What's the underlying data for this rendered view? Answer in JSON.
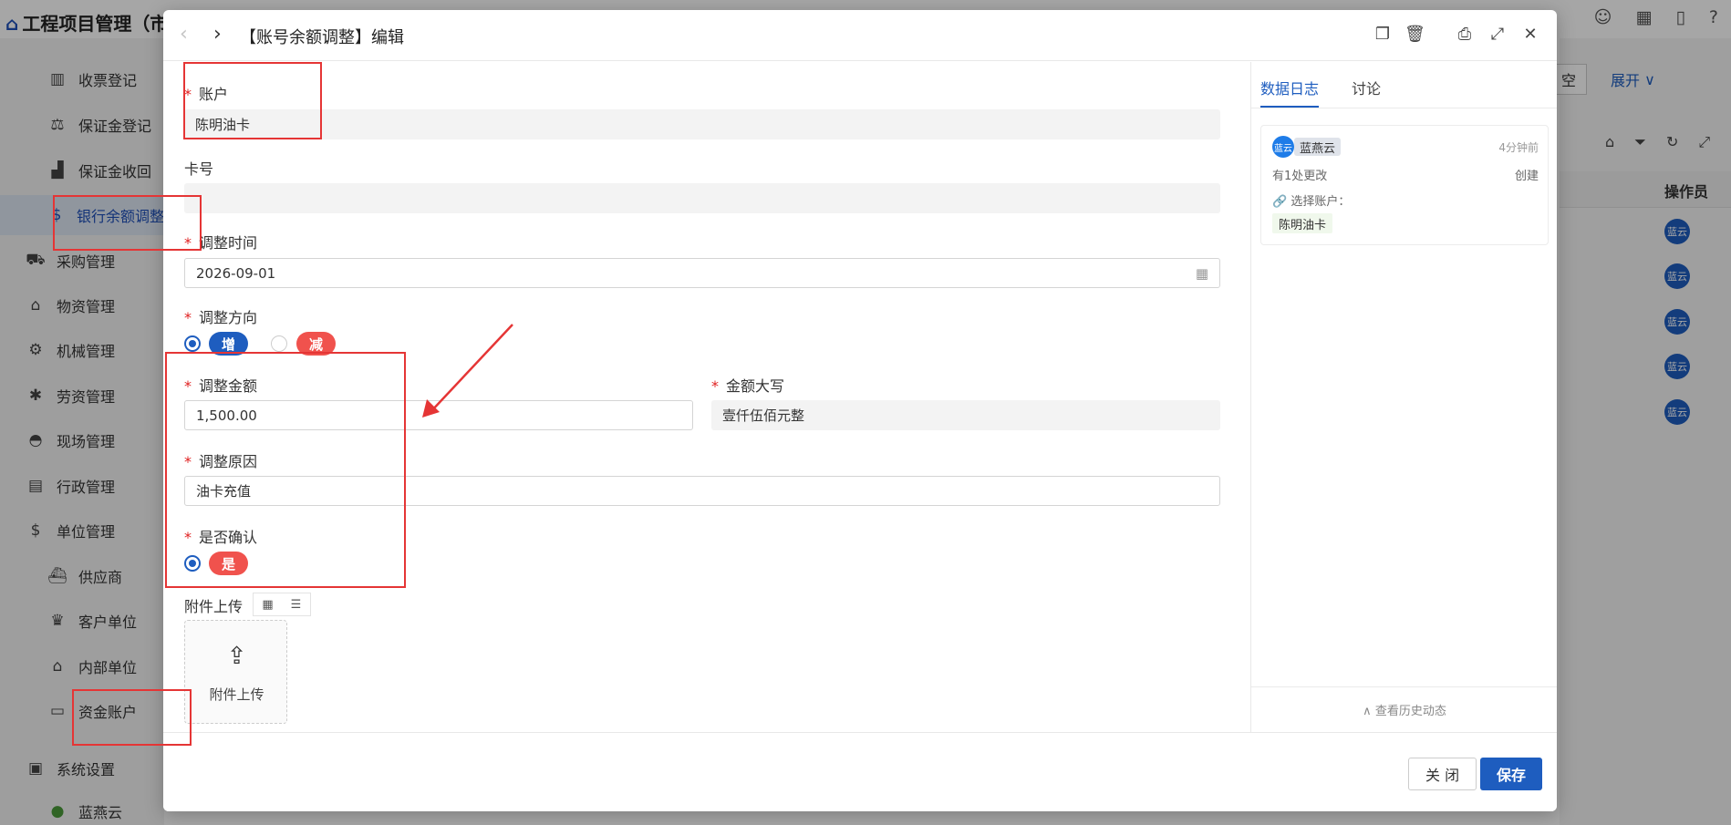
{
  "app": {
    "title": "工程项目管理（市",
    "top_icons": [
      "chat-icon",
      "grid-icon",
      "mobile-icon",
      "help-icon"
    ]
  },
  "sidebar": {
    "items": [
      {
        "label": "收票登记",
        "icon": "barcode-icon",
        "level": 2,
        "active": false
      },
      {
        "label": "保证金登记",
        "icon": "scale-icon",
        "level": 2,
        "active": false
      },
      {
        "label": "保证金收回",
        "icon": "chart-icon",
        "level": 2,
        "active": false
      },
      {
        "label": "银行余额调整",
        "icon": "money-bag-icon",
        "level": 2,
        "active": true
      },
      {
        "label": "采购管理",
        "icon": "truck-icon",
        "level": 1,
        "active": false
      },
      {
        "label": "物资管理",
        "icon": "warehouse-icon",
        "level": 1,
        "active": false
      },
      {
        "label": "机械管理",
        "icon": "gears-icon",
        "level": 1,
        "active": false
      },
      {
        "label": "劳资管理",
        "icon": "worker-icon",
        "level": 1,
        "active": false
      },
      {
        "label": "现场管理",
        "icon": "helmet-icon",
        "level": 1,
        "active": false
      },
      {
        "label": "行政管理",
        "icon": "archive-icon",
        "level": 1,
        "active": false
      },
      {
        "label": "单位管理",
        "icon": "money-bag-icon",
        "level": 1,
        "active": false
      },
      {
        "label": "供应商",
        "icon": "ship-icon",
        "level": 2,
        "active": false
      },
      {
        "label": "客户单位",
        "icon": "crown-icon",
        "level": 2,
        "active": false
      },
      {
        "label": "内部单位",
        "icon": "building-icon",
        "level": 2,
        "active": false
      },
      {
        "label": "资金账户",
        "icon": "card-icon",
        "level": 2,
        "active": false
      },
      {
        "label": "系统设置",
        "icon": "save-icon",
        "level": 1,
        "active": false
      },
      {
        "label": "蓝燕云",
        "icon": "avatar",
        "level": 2,
        "active": false
      }
    ]
  },
  "background": {
    "btn_partial": "空",
    "expand": "展开",
    "col_operator": "操作员",
    "avatar_text": "蓝云",
    "avatar_rows": 5
  },
  "dialog": {
    "title": "【账号余额调整】编辑",
    "fields": {
      "account": {
        "label": "账户",
        "value": "陈明油卡"
      },
      "card_no": {
        "label": "卡号",
        "value": ""
      },
      "adjust_time": {
        "label": "调整时间",
        "value": "2026-09-01"
      },
      "direction": {
        "label": "调整方向",
        "options": [
          "增",
          "减"
        ],
        "selected": "增"
      },
      "amount": {
        "label": "调整金额",
        "value": "1,500.00"
      },
      "amount_upper": {
        "label": "金额大写",
        "value": "壹仟伍佰元整"
      },
      "reason": {
        "label": "调整原因",
        "value": "油卡充值"
      },
      "confirmed": {
        "label": "是否确认",
        "options": [
          "是"
        ],
        "selected": "是"
      },
      "attachment": {
        "label": "附件上传",
        "upload_text": "附件上传"
      }
    },
    "footer": {
      "close_label": "关 闭",
      "save_label": "保存"
    }
  },
  "side_panel": {
    "tabs": [
      "数据日志",
      "讨论"
    ],
    "active_tab": "数据日志",
    "log": {
      "avatar_text": "蓝云",
      "user": "蓝燕云",
      "time": "4分钟前",
      "summary": "有1处更改",
      "action": "创建",
      "field": "选择账户：",
      "value": "陈明油卡"
    },
    "history_link": "∧ 查看历史动态"
  },
  "colors": {
    "primary": "#1e5dbf",
    "danger_pill": "#f0524d",
    "annotation": "#e53535"
  }
}
